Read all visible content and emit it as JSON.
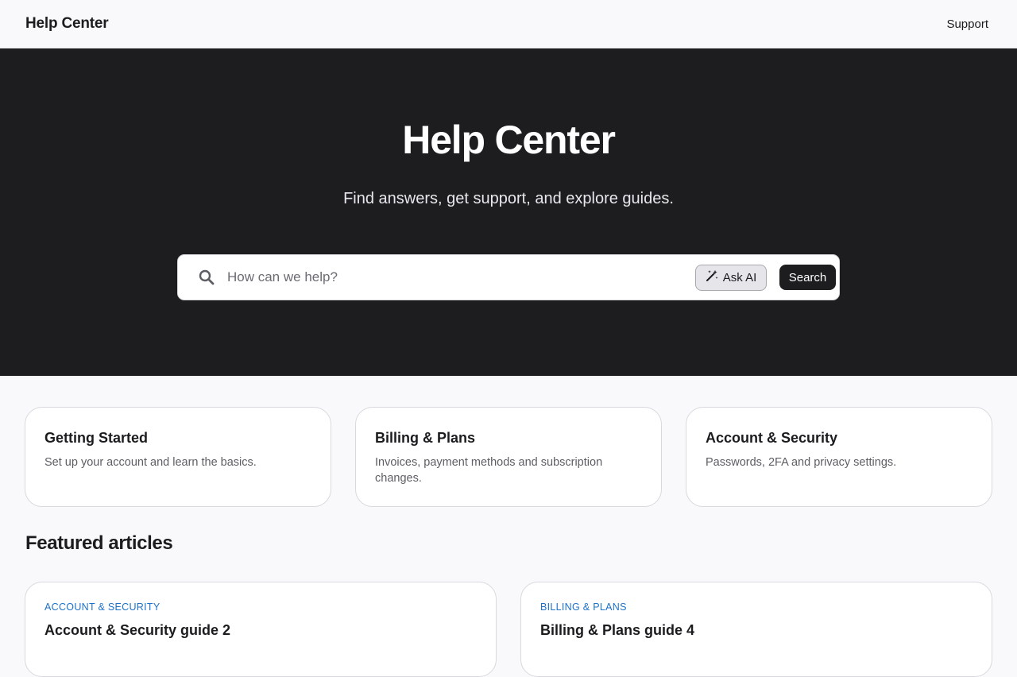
{
  "header": {
    "brand": "Help Center",
    "nav_support": "Support"
  },
  "hero": {
    "title": "Help Center",
    "subtitle": "Find answers, get support, and explore guides.",
    "search_placeholder": "How can we help?",
    "ask_ai_label": "Ask AI",
    "search_label": "Search"
  },
  "categories": [
    {
      "title": "Getting Started",
      "description": "Set up your account and learn the basics."
    },
    {
      "title": "Billing & Plans",
      "description": "Invoices, payment methods and subscription changes."
    },
    {
      "title": "Account & Security",
      "description": "Passwords, 2FA and privacy settings."
    }
  ],
  "featured": {
    "heading": "Featured articles",
    "articles": [
      {
        "category": "ACCOUNT & SECURITY",
        "title": "Account & Security guide 2"
      },
      {
        "category": "BILLING & PLANS",
        "title": "Billing & Plans guide 4"
      }
    ]
  },
  "colors": {
    "hero_background": "#1d1d20",
    "page_background": "#f9f9fb",
    "accent_link": "#1c72c9"
  },
  "icons": {
    "search": "search-icon",
    "ask_ai": "magic-wand-icon"
  }
}
